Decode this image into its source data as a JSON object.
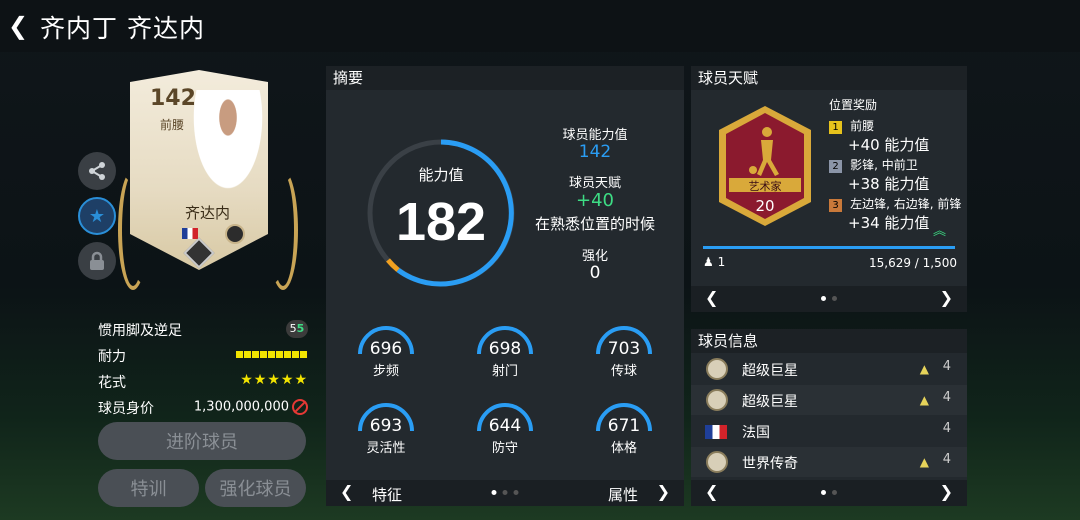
{
  "header": {
    "back_icon": "chevron-left-icon",
    "title": "齐内丁 齐达内"
  },
  "card": {
    "rating": "142",
    "position": "前腰",
    "name": "齐达内"
  },
  "side_buttons": [
    "share-icon",
    "star-icon",
    "lock-icon"
  ],
  "attributes": {
    "foot_label": "惯用脚及逆足",
    "foot_left": "5",
    "foot_right": "5",
    "stamina_label": "耐力",
    "skill_label": "花式",
    "skill_stars": "★★★★★",
    "value_label": "球员身价",
    "value": "1,300,000,000"
  },
  "buttons": {
    "advance": "进阶球员",
    "training": "特训",
    "enhance": "强化球员"
  },
  "summary": {
    "header": "摘要",
    "ovr_label": "能力值",
    "ovr": "182",
    "player_ability_label": "球员能力值",
    "player_ability": "142",
    "talent_label": "球员天赋",
    "talent_value": "+40",
    "talent_desc": "在熟悉位置的时候",
    "enhance_label": "强化",
    "enhance_value": "0",
    "stats": [
      {
        "value": "696",
        "label": "步频"
      },
      {
        "value": "698",
        "label": "射门"
      },
      {
        "value": "703",
        "label": "传球"
      },
      {
        "value": "693",
        "label": "灵活性"
      },
      {
        "value": "644",
        "label": "防守"
      },
      {
        "value": "671",
        "label": "体格"
      }
    ],
    "footer_left": "特征",
    "footer_right": "属性"
  },
  "talent": {
    "header": "球员天赋",
    "badge_label": "艺术家",
    "badge_level": "20",
    "bonus_title": "位置奖励",
    "bonuses": [
      {
        "rank": "1",
        "positions": "前腰",
        "value": "+40 能力值"
      },
      {
        "rank": "2",
        "positions": "影锋, 中前卫",
        "value": "+38 能力值"
      },
      {
        "rank": "3",
        "positions": "左边锋, 右边锋, 前锋",
        "value": "+34 能力值"
      }
    ],
    "count": "1",
    "progress_text": "15,629 / 1,500",
    "progress": 1.0
  },
  "player_info": {
    "header": "球员信息",
    "rows": [
      {
        "label": "超级巨星",
        "count": "4"
      },
      {
        "label": "超级巨星",
        "count": "4"
      },
      {
        "label": "法国",
        "count": "4"
      },
      {
        "label": "世界传奇",
        "count": "4"
      }
    ]
  },
  "colors": {
    "accent_blue": "#2a9df4",
    "ring_orange": "#f0a020",
    "talent_green": "#3ddc84",
    "badge_red": "#8b1a2e",
    "badge_gold": "#d9a93a"
  }
}
